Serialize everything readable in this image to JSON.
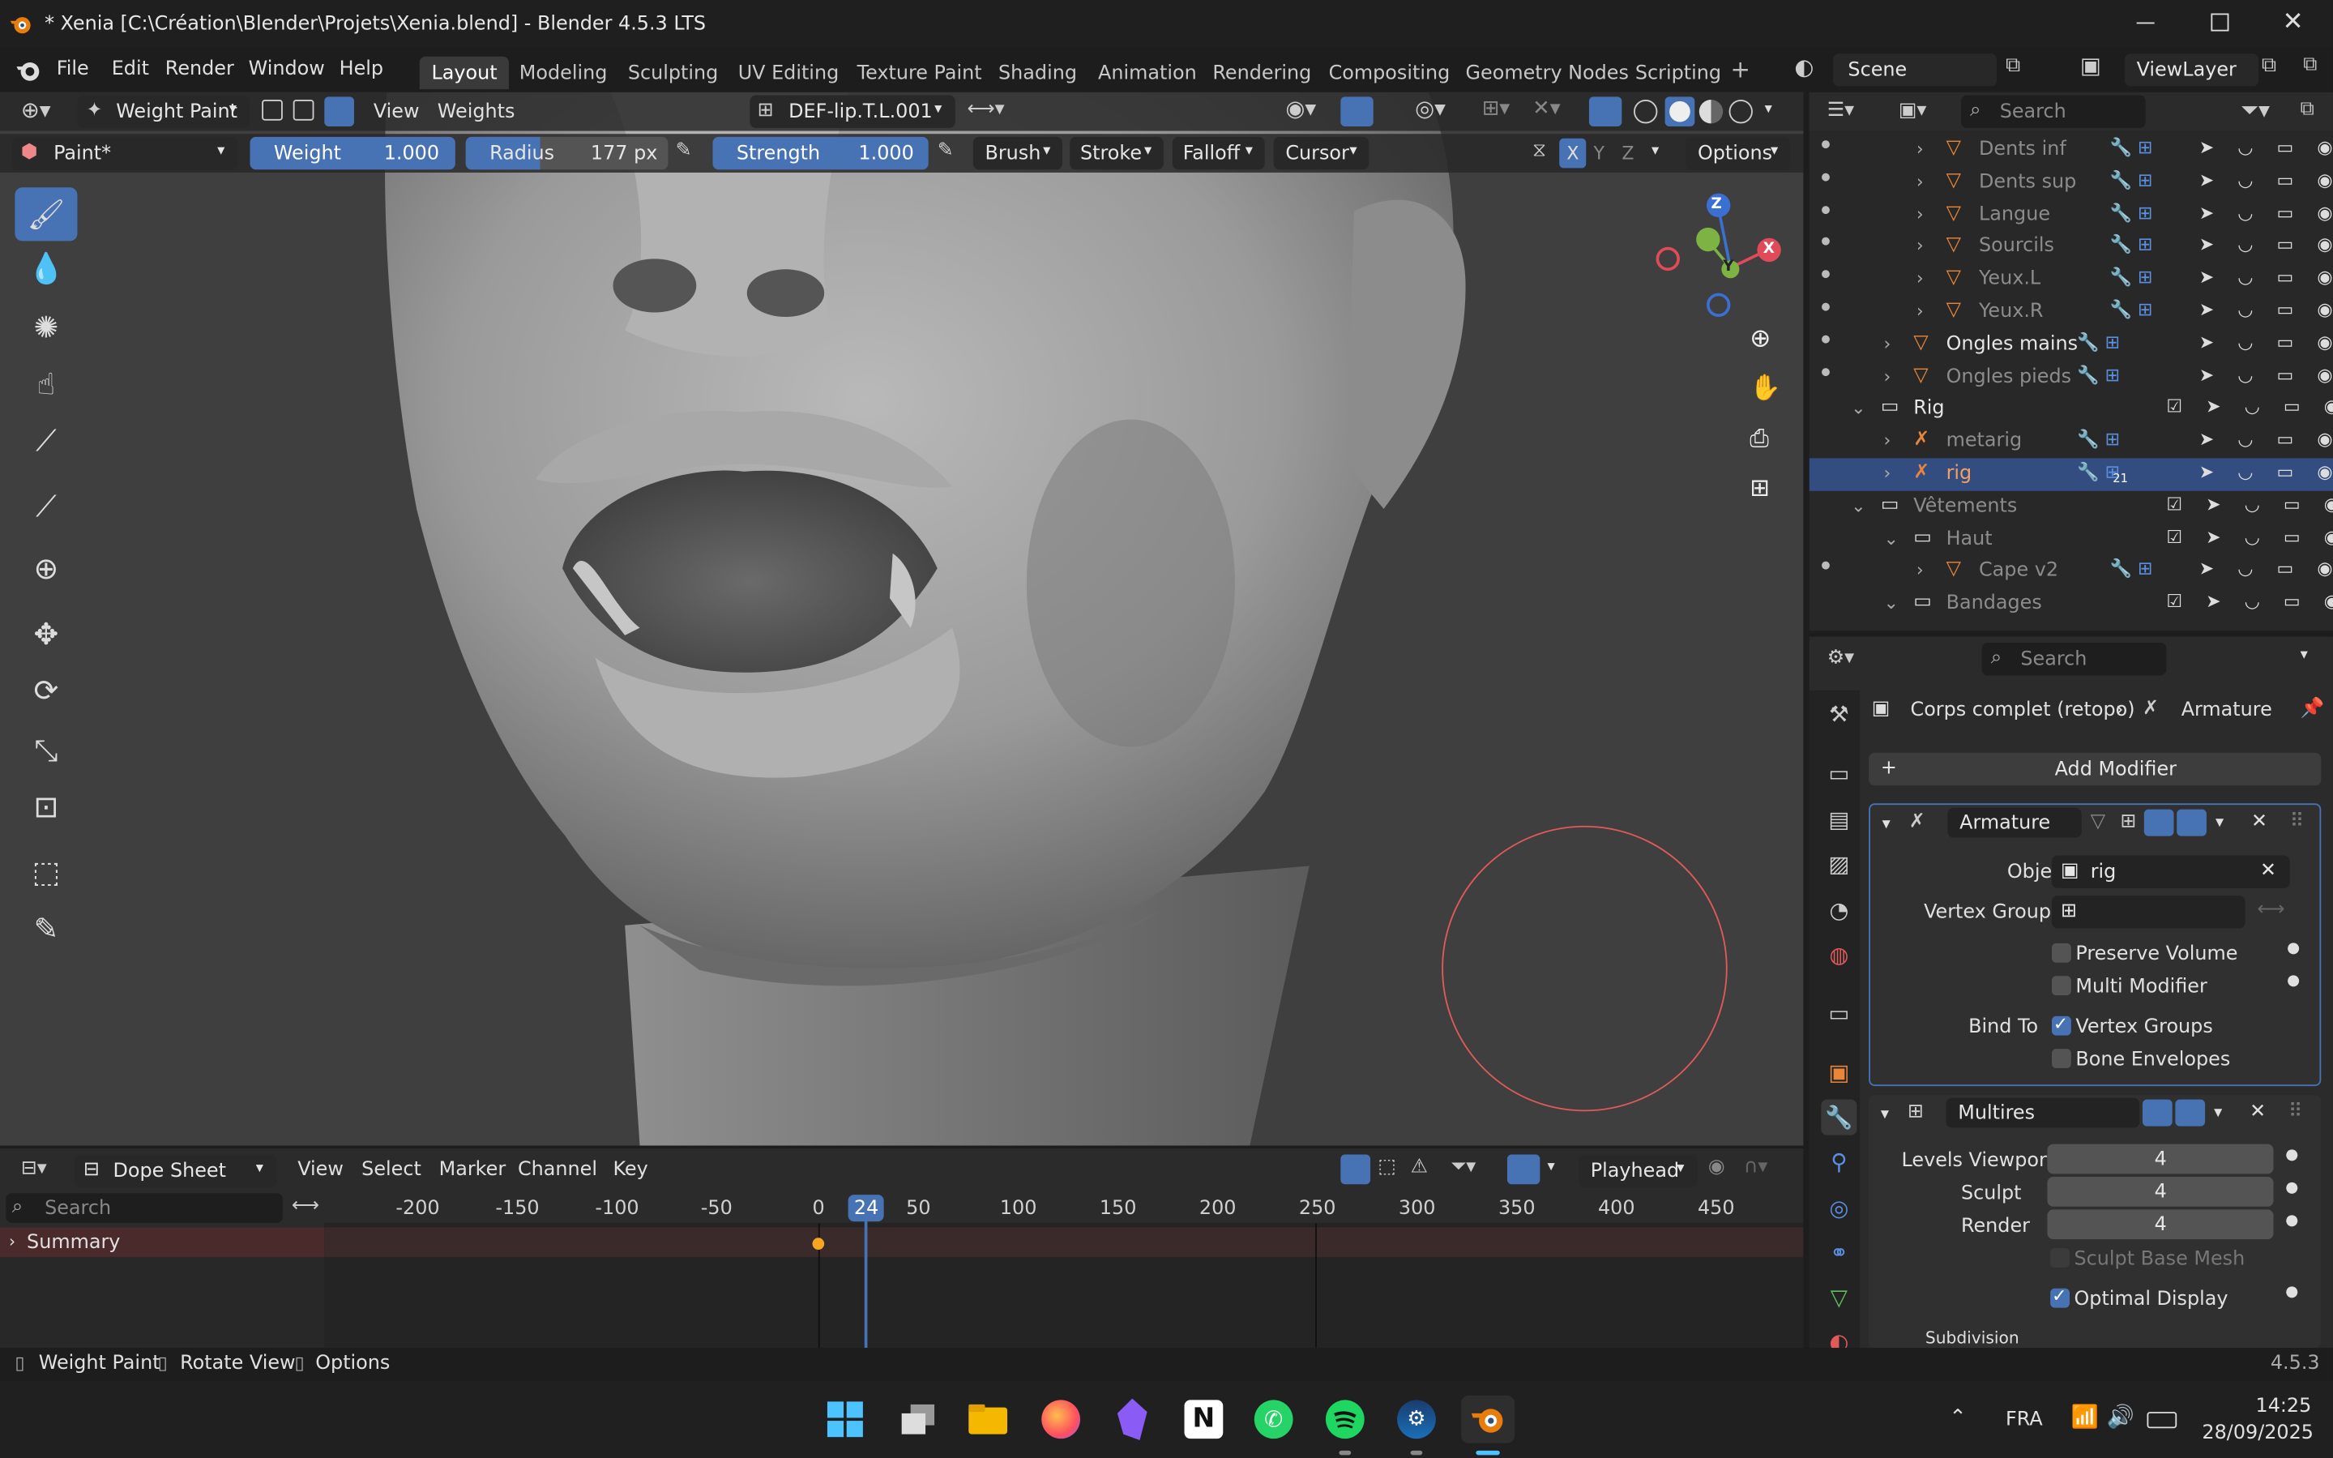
{
  "window": {
    "title": "* Xenia [C:\\Création\\Blender\\Projets\\Xenia.blend] - Blender 4.5.3 LTS",
    "controls": [
      "minimize",
      "maximize",
      "close"
    ]
  },
  "menu": {
    "items": [
      "File",
      "Edit",
      "Render",
      "Window",
      "Help"
    ],
    "workspaces": [
      "Layout",
      "Modeling",
      "Sculpting",
      "UV Editing",
      "Texture Paint",
      "Shading",
      "Animation",
      "Rendering",
      "Compositing",
      "Geometry Nodes",
      "Scripting"
    ],
    "active_workspace": "Layout",
    "scene": "Scene",
    "view_layer": "ViewLayer"
  },
  "viewport_header": {
    "mode": "Weight Paint",
    "menus": [
      "View",
      "Weights"
    ],
    "vertex_group": "DEF-lip.T.L.001"
  },
  "tool_settings": {
    "brush_name": "Paint*",
    "weight_label": "Weight",
    "weight_value": "1.000",
    "radius_label": "Radius",
    "radius_value": "177 px",
    "strength_label": "Strength",
    "strength_value": "1.000",
    "dropdowns": [
      "Brush",
      "Stroke",
      "Falloff",
      "Cursor"
    ],
    "axes": [
      "X",
      "Y",
      "Z"
    ],
    "options": "Options"
  },
  "gizmo": {
    "axes": [
      "Z",
      "Y",
      "X"
    ]
  },
  "outliner": {
    "search_placeholder": "Search",
    "rows": [
      {
        "name": "Dents inf",
        "indent": 3,
        "dim": true
      },
      {
        "name": "Dents sup",
        "indent": 3,
        "dim": true
      },
      {
        "name": "Langue",
        "indent": 3,
        "dim": true
      },
      {
        "name": "Sourcils",
        "indent": 3,
        "dim": true
      },
      {
        "name": "Yeux.L",
        "indent": 3,
        "dim": true
      },
      {
        "name": "Yeux.R",
        "indent": 3,
        "dim": true
      },
      {
        "name": "Ongles mains",
        "indent": 2,
        "dim": false
      },
      {
        "name": "Ongles pieds",
        "indent": 2,
        "dim": true
      },
      {
        "name": "Rig",
        "indent": 1,
        "dim": false
      },
      {
        "name": "metarig",
        "indent": 2,
        "dim": true
      },
      {
        "name": "rig",
        "indent": 2,
        "dim": false,
        "selected": true
      },
      {
        "name": "Vêtements",
        "indent": 1,
        "dim": true
      },
      {
        "name": "Haut",
        "indent": 2,
        "dim": true
      },
      {
        "name": "Cape v2",
        "indent": 3,
        "dim": true
      },
      {
        "name": "Bandages",
        "indent": 2,
        "dim": true
      }
    ],
    "badge": "21"
  },
  "properties": {
    "search_placeholder": "Search",
    "breadcrumb_object": "Corps complet (retopo)",
    "breadcrumb_modifier": "Armature",
    "add_modifier": "Add Modifier",
    "armature": {
      "name": "Armature",
      "object_label": "Object",
      "object_value": "rig",
      "vertex_group_label": "Vertex Group",
      "preserve_volume": "Preserve Volume",
      "multi_modifier": "Multi Modifier",
      "bind_to_label": "Bind To",
      "vertex_groups": "Vertex Groups",
      "bone_envelopes": "Bone Envelopes"
    },
    "multires": {
      "name": "Multires",
      "levels_viewport_label": "Levels Viewport",
      "levels_viewport": "4",
      "sculpt_label": "Sculpt",
      "sculpt": "4",
      "render_label": "Render",
      "render": "4",
      "sculpt_base_mesh": "Sculpt Base Mesh",
      "optimal_display": "Optimal Display",
      "subdivision": "Subdivision"
    }
  },
  "dopesheet": {
    "editor": "Dope Sheet",
    "menus": [
      "View",
      "Select",
      "Marker",
      "Channel",
      "Key"
    ],
    "playhead": "Playhead",
    "search_placeholder": "Search",
    "summary": "Summary",
    "current_frame": "24",
    "ticks": [
      "-200",
      "-150",
      "-100",
      "-50",
      "0",
      "50",
      "100",
      "150",
      "200",
      "250",
      "300",
      "350",
      "400",
      "450"
    ]
  },
  "statusbar": {
    "items": [
      "Weight Paint",
      "Rotate View",
      "Options"
    ],
    "version": "4.5.3"
  },
  "taskbar": {
    "language": "FRA",
    "time": "14:25",
    "date": "28/09/2025"
  },
  "colors": {
    "accent_blue": "#4772b3",
    "selection_row": "#334d80",
    "brush_circle": "#e05a5a",
    "orange": "#e8863a"
  }
}
